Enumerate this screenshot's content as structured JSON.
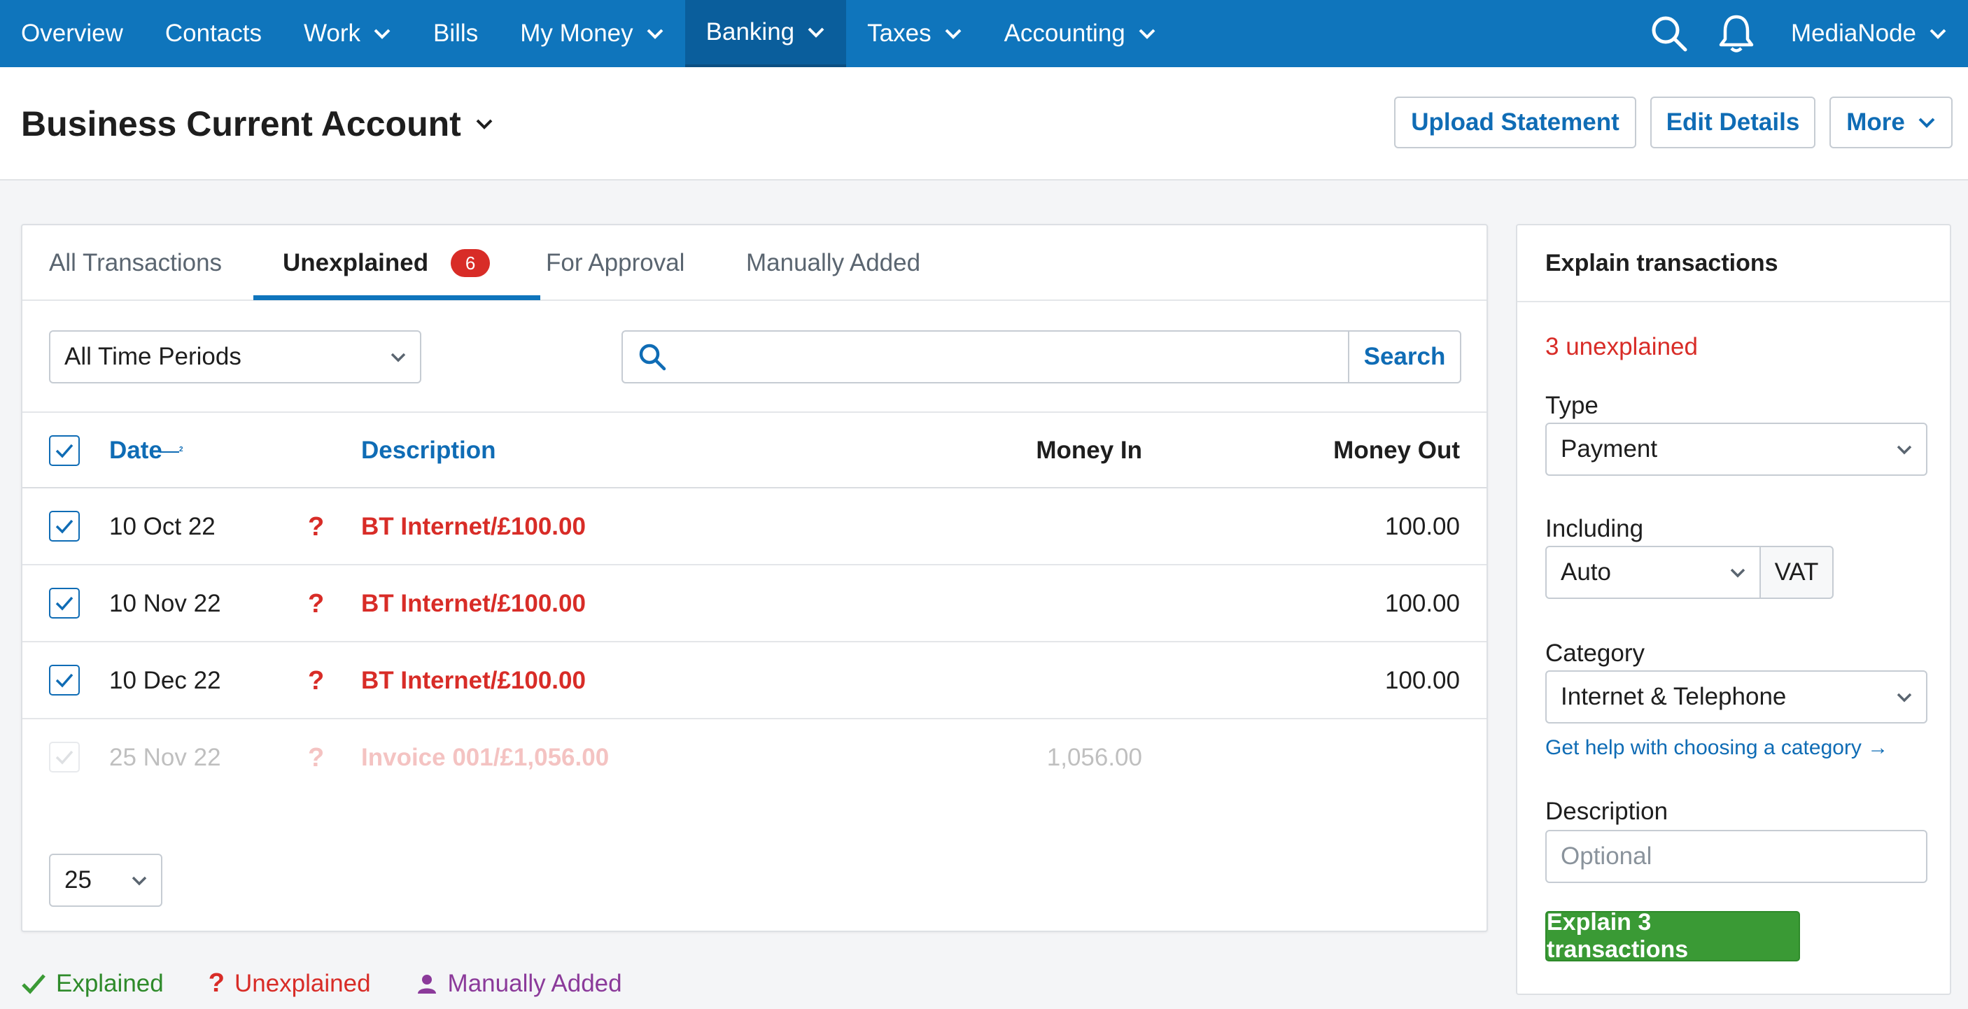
{
  "nav": {
    "items": [
      {
        "label": "Overview",
        "dropdown": false
      },
      {
        "label": "Contacts",
        "dropdown": false
      },
      {
        "label": "Work",
        "dropdown": true
      },
      {
        "label": "Bills",
        "dropdown": false
      },
      {
        "label": "My Money",
        "dropdown": true
      },
      {
        "label": "Banking",
        "dropdown": true,
        "active": true
      },
      {
        "label": "Taxes",
        "dropdown": true
      },
      {
        "label": "Accounting",
        "dropdown": true
      }
    ],
    "user": "MediaNode"
  },
  "header": {
    "title": "Business Current Account",
    "buttons": {
      "upload": "Upload Statement",
      "edit": "Edit Details",
      "more": "More"
    }
  },
  "tabs": [
    {
      "label": "All Transactions"
    },
    {
      "label": "Unexplained",
      "badge": "6",
      "active": true
    },
    {
      "label": "For Approval"
    },
    {
      "label": "Manually Added"
    }
  ],
  "filters": {
    "period": "All Time Periods",
    "search_value": "",
    "search_button": "Search"
  },
  "table": {
    "columns": {
      "date": "Date",
      "description": "Description",
      "money_in": "Money In",
      "money_out": "Money Out"
    },
    "rows": [
      {
        "date": "10 Oct 22",
        "status": "?",
        "description": "BT Internet/£100.00",
        "money_in": "",
        "money_out": "100.00",
        "checked": true
      },
      {
        "date": "10 Nov 22",
        "status": "?",
        "description": "BT Internet/£100.00",
        "money_in": "",
        "money_out": "100.00",
        "checked": true
      },
      {
        "date": "10 Dec 22",
        "status": "?",
        "description": "BT Internet/£100.00",
        "money_in": "",
        "money_out": "100.00",
        "checked": true
      },
      {
        "date": "25 Nov 22",
        "status": "?",
        "description": "Invoice 001/£1,056.00",
        "money_in": "1,056.00",
        "money_out": "",
        "checked": true,
        "disabled": true
      }
    ],
    "page_size": "25"
  },
  "legend": {
    "explained": "Explained",
    "unexplained": "Unexplained",
    "manual": "Manually Added"
  },
  "side": {
    "title": "Explain transactions",
    "unexplained_count": "3 unexplained",
    "type_label": "Type",
    "type_value": "Payment",
    "including_label": "Including",
    "including_value": "Auto",
    "vat": "VAT",
    "category_label": "Category",
    "category_value": "Internet & Telephone",
    "help_link": "Get help with choosing a category →",
    "description_label": "Description",
    "description_placeholder": "Optional",
    "submit": "Explain 3 transactions"
  },
  "colors": {
    "nav_bg": "#0f75bc",
    "link": "#0f6cb5",
    "unexplained_red": "#d82c27",
    "primary_green": "#3a9a35",
    "manual_purple": "#8b3a9a"
  }
}
